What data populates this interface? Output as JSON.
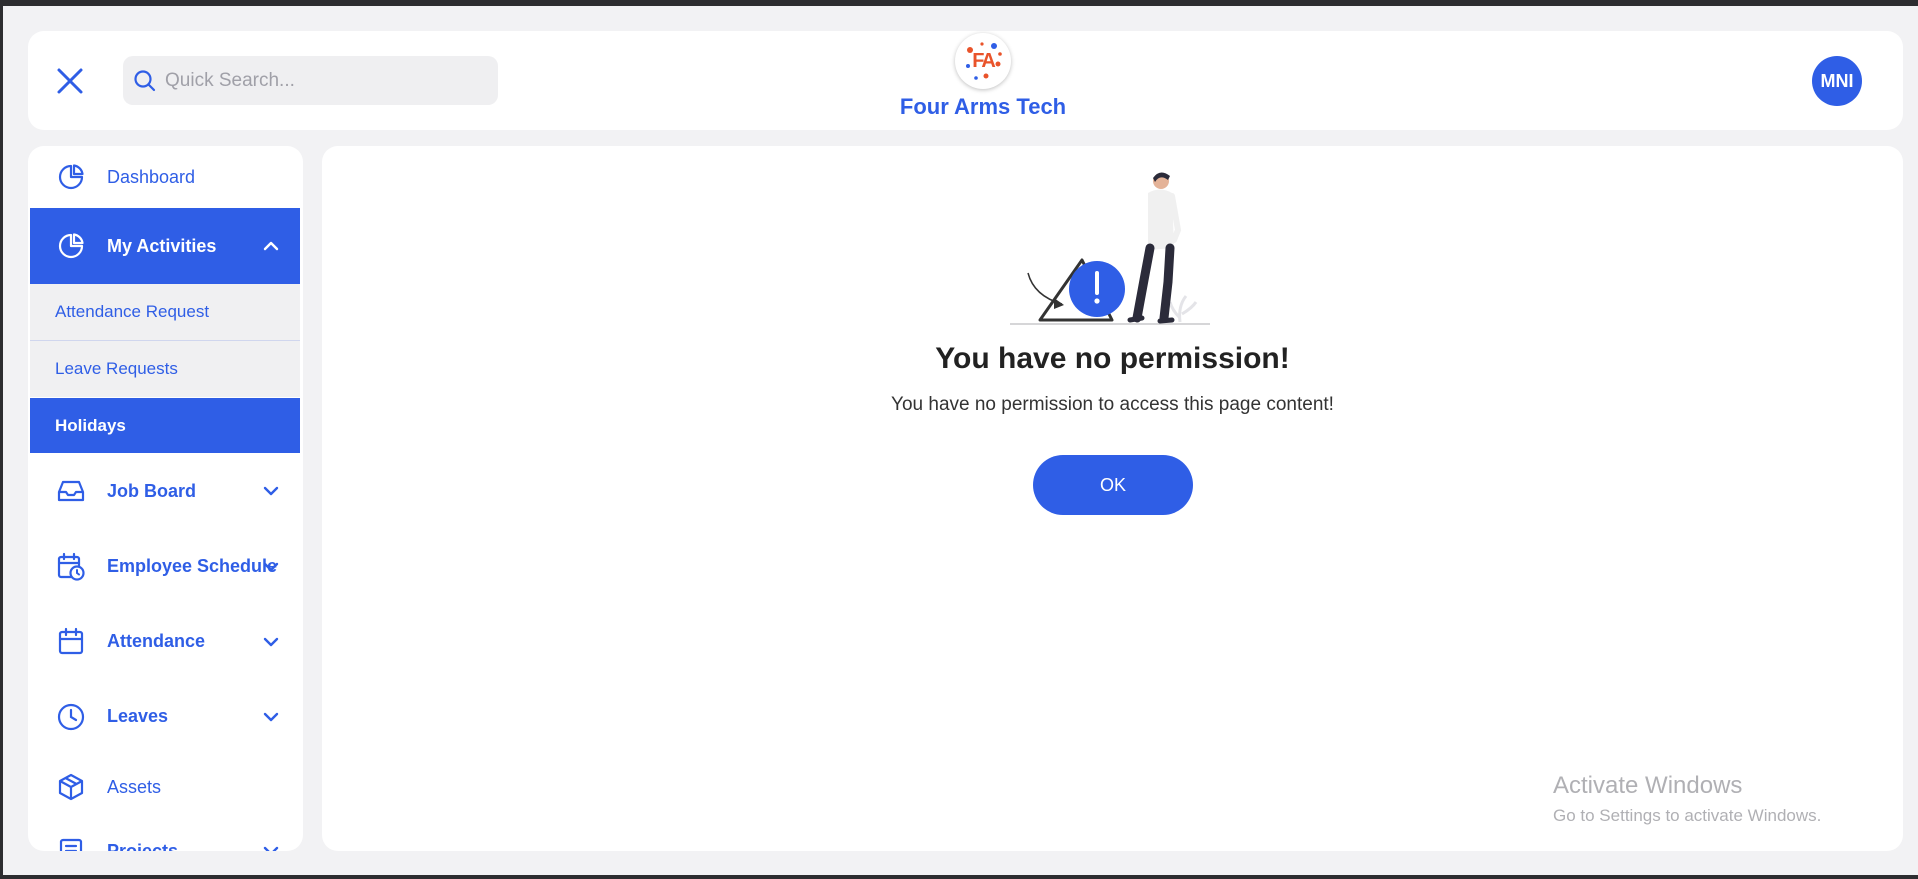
{
  "header": {
    "search_placeholder": "Quick Search...",
    "brand_name": "Four Arms Tech",
    "logo_text": "FA",
    "avatar_initials": "MNI"
  },
  "sidebar": {
    "items": [
      {
        "label": "Dashboard",
        "icon": "pie-chart-icon"
      },
      {
        "label": "My Activities",
        "icon": "pie-chart-icon",
        "expanded": true
      },
      {
        "label": "Job Board",
        "icon": "inbox-icon"
      },
      {
        "label": "Employee Schedule",
        "icon": "calendar-clock-icon"
      },
      {
        "label": "Attendance",
        "icon": "calendar-icon"
      },
      {
        "label": "Leaves",
        "icon": "clock-icon"
      },
      {
        "label": "Assets",
        "icon": "box-icon"
      },
      {
        "label": "Projects",
        "icon": "document-icon"
      }
    ],
    "sub_items": [
      {
        "label": "Attendance Request"
      },
      {
        "label": "Leave Requests"
      },
      {
        "label": "Holidays",
        "active": true
      }
    ]
  },
  "main": {
    "title": "You have no permission!",
    "message": "You have no permission to access this page content!",
    "ok_label": "OK"
  },
  "watermark": {
    "title": "Activate Windows",
    "subtitle": "Go to Settings to activate Windows."
  },
  "colors": {
    "accent": "#2f5ee6",
    "background": "#f2f2f4",
    "submenu_bg": "#f0f0f2"
  }
}
